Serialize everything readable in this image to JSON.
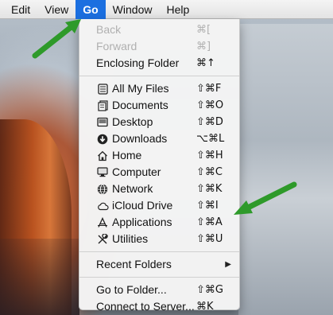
{
  "menubar": {
    "items": [
      {
        "label": "Edit"
      },
      {
        "label": "View"
      },
      {
        "label": "Go"
      },
      {
        "label": "Window"
      },
      {
        "label": "Help"
      }
    ],
    "active_index": 2
  },
  "go_menu": {
    "history": [
      {
        "label": "Back",
        "shortcut": "⌘[",
        "enabled": false
      },
      {
        "label": "Forward",
        "shortcut": "⌘]",
        "enabled": false
      },
      {
        "label": "Enclosing Folder",
        "shortcut": "⌘↑",
        "enabled": true
      }
    ],
    "places": [
      {
        "label": "All My Files",
        "shortcut": "⇧⌘F",
        "icon": "all-my-files-icon"
      },
      {
        "label": "Documents",
        "shortcut": "⇧⌘O",
        "icon": "documents-icon"
      },
      {
        "label": "Desktop",
        "shortcut": "⇧⌘D",
        "icon": "desktop-icon"
      },
      {
        "label": "Downloads",
        "shortcut": "⌥⌘L",
        "icon": "downloads-icon"
      },
      {
        "label": "Home",
        "shortcut": "⇧⌘H",
        "icon": "home-icon"
      },
      {
        "label": "Computer",
        "shortcut": "⇧⌘C",
        "icon": "computer-icon"
      },
      {
        "label": "Network",
        "shortcut": "⇧⌘K",
        "icon": "network-icon"
      },
      {
        "label": "iCloud Drive",
        "shortcut": "⇧⌘I",
        "icon": "icloud-icon"
      },
      {
        "label": "Applications",
        "shortcut": "⇧⌘A",
        "icon": "applications-icon"
      },
      {
        "label": "Utilities",
        "shortcut": "⇧⌘U",
        "icon": "utilities-icon"
      }
    ],
    "recent_folders": {
      "label": "Recent Folders",
      "submenu_icon": "chevron-right-icon"
    },
    "connect": [
      {
        "label": "Go to Folder...",
        "shortcut": "⇧⌘G"
      },
      {
        "label": "Connect to Server...",
        "shortcut": "⌘K"
      }
    ]
  },
  "colors": {
    "menubar_active": "#1b6fe0",
    "annotation_arrow": "#2e9a2a",
    "disabled_text": "#b0b0b0"
  }
}
